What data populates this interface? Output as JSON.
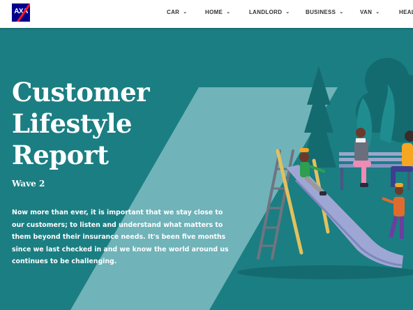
{
  "brand": {
    "logo_text": "AXA"
  },
  "nav": {
    "items": [
      {
        "label": "CAR"
      },
      {
        "label": "HOME"
      },
      {
        "label": "LANDLORD"
      },
      {
        "label": "BUSINESS"
      },
      {
        "label": "VAN"
      },
      {
        "label": "HEALTH"
      }
    ]
  },
  "hero": {
    "title_line1": "Customer",
    "title_line2": "Lifestyle",
    "title_line3": "Report",
    "subtitle": "Wave 2",
    "intro": "Now more than ever, it is important that we stay close to our customers; to listen and understand what matters to them beyond their insurance needs. It's been five months since we last checked in and we know the world around us continues to be challenging."
  },
  "colors": {
    "hero_background": "#1b7e82",
    "brand_blue": "#00008f",
    "brand_red": "#ff1721"
  }
}
